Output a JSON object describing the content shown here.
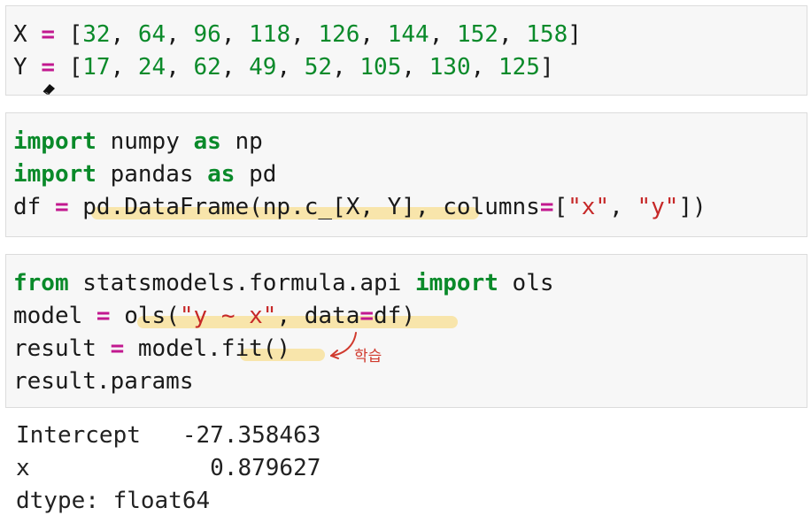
{
  "cells": [
    {
      "lines": [
        {
          "var": "X",
          "eq": "=",
          "open": "[",
          "nums": [
            "32",
            "64",
            "96",
            "118",
            "126",
            "144",
            "152",
            "158"
          ],
          "close": "]"
        },
        {
          "var": "Y",
          "eq": "=",
          "open": "[",
          "nums": [
            "17",
            "24",
            "62",
            "49",
            "52",
            "105",
            "130",
            "125"
          ],
          "close": "]"
        }
      ]
    },
    {
      "line1": {
        "kw1": "import",
        "mod": " numpy ",
        "kw2": "as",
        "alias": " np"
      },
      "line2": {
        "kw1": "import",
        "mod": " pandas ",
        "kw2": "as",
        "alias": " pd"
      },
      "line3": {
        "lhs": "df ",
        "eq": "=",
        "call": " pd.DataFrame(np.c_[X, Y], columns",
        "eq2": "=",
        "lb": "[",
        "s1": "\"x\"",
        "comma": ", ",
        "s2": "\"y\"",
        "rb": "])"
      }
    },
    {
      "line1": {
        "kw1": "from",
        "mod": " statsmodels.formula.api ",
        "kw2": "import",
        "name": " ols"
      },
      "line2": {
        "lhs": "model ",
        "eq": "=",
        "pre": " ols(",
        "str": "\"y ~ x\"",
        "mid": ", data",
        "eq2": "=",
        "post": "df)"
      },
      "line3": {
        "lhs": "result ",
        "eq": "=",
        "rhs": " model.fit()"
      },
      "line4": {
        "text": "result.params"
      }
    }
  ],
  "annotation": "학습",
  "output": [
    "Intercept   -27.358463",
    "x             0.879627",
    "dtype: float64"
  ],
  "colors": {
    "keyword": "#0a8a2a",
    "operator": "#c2188f",
    "number": "#0a8a2a",
    "string": "#c62828",
    "highlight": "#fad76e",
    "annotation": "#d03a2e"
  }
}
